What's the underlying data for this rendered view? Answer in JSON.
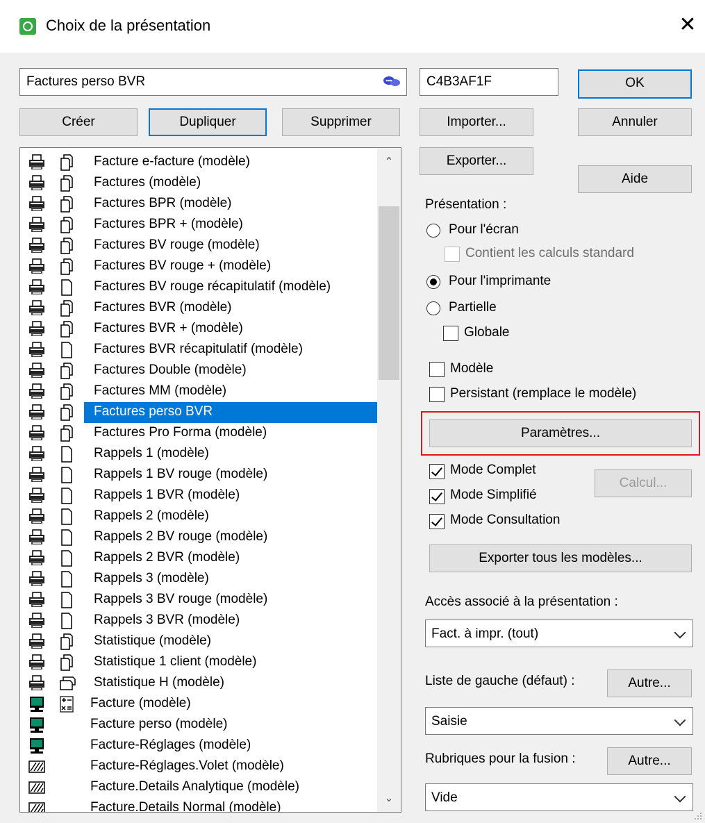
{
  "window": {
    "title": "Choix de la présentation"
  },
  "name_field": {
    "value": "Factures perso BVR"
  },
  "code_field": {
    "value": "C4B3AF1F"
  },
  "buttons": {
    "ok": "OK",
    "cancel": "Annuler",
    "help": "Aide",
    "create": "Créer",
    "duplicate": "Dupliquer",
    "delete": "Supprimer",
    "import": "Importer...",
    "export": "Exporter...",
    "parameters": "Paramètres...",
    "compute": "Calcul...",
    "export_all": "Exporter tous les modèles...",
    "other_left": "Autre...",
    "other_merge": "Autre..."
  },
  "list": {
    "selected_index": 12,
    "items": [
      {
        "label": "Facture e-facture (modèle)",
        "icon1": "printer-icon",
        "icon2": "pages-icon"
      },
      {
        "label": "Factures (modèle)",
        "icon1": "printer-icon",
        "icon2": "pages-icon"
      },
      {
        "label": "Factures BPR (modèle)",
        "icon1": "printer-icon",
        "icon2": "pages-icon"
      },
      {
        "label": "Factures BPR + (modèle)",
        "icon1": "printer-icon",
        "icon2": "pages-icon"
      },
      {
        "label": "Factures BV rouge (modèle)",
        "icon1": "printer-icon",
        "icon2": "pages-icon"
      },
      {
        "label": "Factures BV rouge + (modèle)",
        "icon1": "printer-icon",
        "icon2": "pages-icon"
      },
      {
        "label": "Factures BV rouge récapitulatif (modèle)",
        "icon1": "printer-icon",
        "icon2": "page-icon"
      },
      {
        "label": "Factures BVR (modèle)",
        "icon1": "printer-icon",
        "icon2": "pages-icon"
      },
      {
        "label": "Factures BVR + (modèle)",
        "icon1": "printer-icon",
        "icon2": "pages-icon"
      },
      {
        "label": "Factures BVR récapitulatif (modèle)",
        "icon1": "printer-icon",
        "icon2": "page-icon"
      },
      {
        "label": "Factures Double (modèle)",
        "icon1": "printer-icon",
        "icon2": "pages-icon"
      },
      {
        "label": "Factures MM (modèle)",
        "icon1": "printer-icon",
        "icon2": "pages-icon"
      },
      {
        "label": "Factures perso BVR",
        "icon1": "printer-icon",
        "icon2": "pages-icon"
      },
      {
        "label": "Factures Pro Forma (modèle)",
        "icon1": "printer-icon",
        "icon2": "pages-icon"
      },
      {
        "label": "Rappels 1 (modèle)",
        "icon1": "printer-icon",
        "icon2": "page-icon"
      },
      {
        "label": "Rappels 1 BV rouge (modèle)",
        "icon1": "printer-icon",
        "icon2": "page-icon"
      },
      {
        "label": "Rappels 1 BVR (modèle)",
        "icon1": "printer-icon",
        "icon2": "page-icon"
      },
      {
        "label": "Rappels 2 (modèle)",
        "icon1": "printer-icon",
        "icon2": "page-icon"
      },
      {
        "label": "Rappels 2 BV rouge (modèle)",
        "icon1": "printer-icon",
        "icon2": "page-icon"
      },
      {
        "label": "Rappels 2 BVR (modèle)",
        "icon1": "printer-icon",
        "icon2": "page-icon"
      },
      {
        "label": "Rappels 3 (modèle)",
        "icon1": "printer-icon",
        "icon2": "page-icon"
      },
      {
        "label": "Rappels 3 BV rouge (modèle)",
        "icon1": "printer-icon",
        "icon2": "page-icon"
      },
      {
        "label": "Rappels 3 BVR (modèle)",
        "icon1": "printer-icon",
        "icon2": "page-icon"
      },
      {
        "label": "Statistique (modèle)",
        "icon1": "printer-icon",
        "icon2": "pages-icon"
      },
      {
        "label": "Statistique 1 client (modèle)",
        "icon1": "printer-icon",
        "icon2": "pages-icon"
      },
      {
        "label": "Statistique H (modèle)",
        "icon1": "printer-icon",
        "icon2": "landscape-pages-icon"
      },
      {
        "label": "Facture (modèle)",
        "icon1": "monitor-icon",
        "icon2": "calculator-icon"
      },
      {
        "label": "Facture perso (modèle)",
        "icon1": "monitor-icon",
        "icon2": ""
      },
      {
        "label": "Facture-Réglages (modèle)",
        "icon1": "monitor-icon",
        "icon2": ""
      },
      {
        "label": "Facture-Réglages.Volet (modèle)",
        "icon1": "hatched-icon",
        "icon2": ""
      },
      {
        "label": "Facture.Details Analytique (modèle)",
        "icon1": "hatched-icon",
        "icon2": ""
      },
      {
        "label": "Facture.Details Normal (modèle)",
        "icon1": "hatched-icon",
        "icon2": ""
      }
    ]
  },
  "presentation": {
    "heading": "Présentation :",
    "screen": "Pour l'écran",
    "standard_calcs": "Contient les calculs standard",
    "printer": "Pour l'imprimante",
    "partial": "Partielle",
    "global": "Globale",
    "selected": "printer"
  },
  "options": {
    "model": "Modèle",
    "persistent": "Persistant (remplace le modèle)",
    "mode_full": "Mode Complet",
    "mode_simple": "Mode Simplifié",
    "mode_consult": "Mode Consultation"
  },
  "access": {
    "label": "Accès associé à la présentation :",
    "value": "Fact. à impr. (tout)"
  },
  "left_list": {
    "label": "Liste de gauche (défaut) :",
    "value": "Saisie"
  },
  "merge": {
    "label": "Rubriques pour la fusion :",
    "value": "Vide"
  },
  "colors": {
    "selection": "#0078d7",
    "highlight_border": "#e81123"
  }
}
